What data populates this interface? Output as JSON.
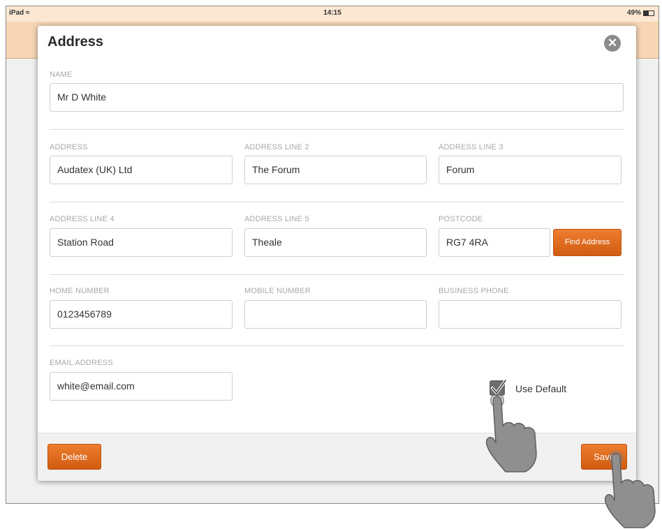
{
  "status_bar": {
    "device": "iPad",
    "wifi_icon": "wifi-icon",
    "time": "14:15",
    "battery": "49%",
    "battery_level": 0.49
  },
  "modal": {
    "title": "Address",
    "close_icon": "close-icon",
    "fields": {
      "name": {
        "label": "NAME",
        "value": "Mr D White"
      },
      "address": {
        "label": "ADDRESS",
        "value": "Audatex (UK) Ltd"
      },
      "address_line_2": {
        "label": "ADDRESS LINE 2",
        "value": "The Forum"
      },
      "address_line_3": {
        "label": "ADDRESS LINE 3",
        "value": "Forum"
      },
      "address_line_4": {
        "label": "ADDRESS LINE 4",
        "value": "Station Road"
      },
      "address_line_5": {
        "label": "ADDRESS LINE 5",
        "value": "Theale"
      },
      "postcode": {
        "label": "POSTCODE",
        "value": "RG7 4RA"
      },
      "home_number": {
        "label": "HOME NUMBER",
        "value": "0123456789"
      },
      "mobile_number": {
        "label": "MOBILE NUMBER",
        "value": ""
      },
      "business_phone": {
        "label": "BUSINESS PHONE",
        "value": ""
      },
      "email": {
        "label": "EMAIL ADDRESS",
        "value": "white@email.com"
      }
    },
    "find_address_label": "Find Address",
    "use_default": {
      "label": "Use Default",
      "checked": true
    },
    "delete_label": "Delete",
    "save_label": "Save"
  },
  "colors": {
    "accent": "#e46e1f",
    "status_bar": "#fbe8d2"
  }
}
